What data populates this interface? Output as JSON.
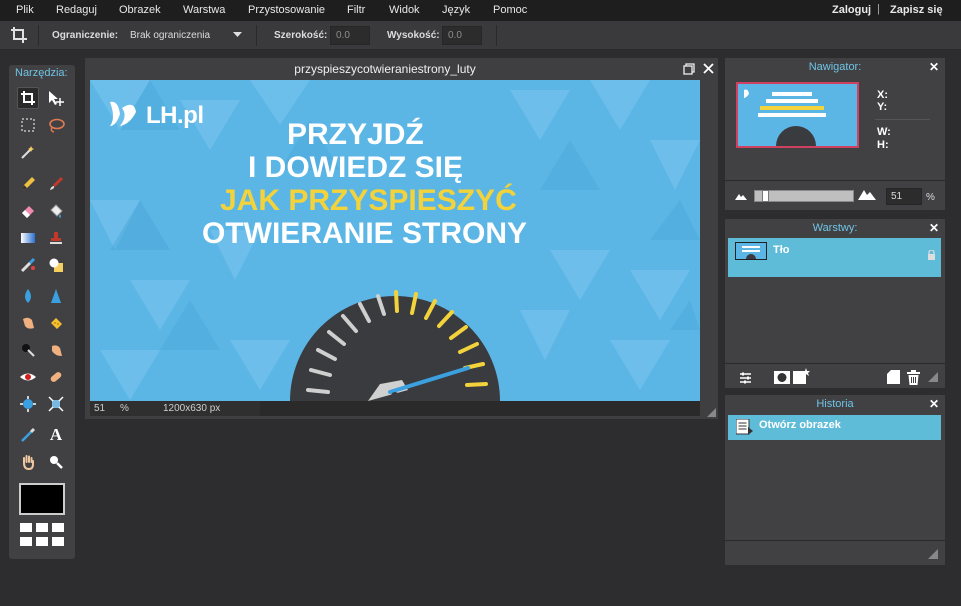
{
  "menu": {
    "items": [
      "Plik",
      "Redaguj",
      "Obrazek",
      "Warstwa",
      "Przystosowanie",
      "Filtr",
      "Widok",
      "Język",
      "Pomoc"
    ],
    "login": "Zaloguj",
    "separator": "|",
    "signup": "Zapisz się"
  },
  "options": {
    "constraint_label": "Ograniczenie:",
    "constraint_value": "Brak ograniczenia",
    "width_label": "Szerokość:",
    "width_value": "0.0",
    "height_label": "Wysokość:",
    "height_value": "0.0"
  },
  "tools": {
    "title": "Narzędzia:"
  },
  "canvas": {
    "title": "przyspieszycotwieraniestrony_luty",
    "zoom": "51",
    "zoom_unit": "%",
    "dimensions": "1200x630 px",
    "artwork": {
      "logo": "LH.pl",
      "line1": "PRZYJDŹ",
      "line2": "I DOWIEDZ SIĘ",
      "line3": "JAK PRZYSPIESZYĆ",
      "line4": "OTWIERANIE STRONY"
    }
  },
  "navigator": {
    "title": "Nawigator:",
    "x_label": "X:",
    "y_label": "Y:",
    "w_label": "W:",
    "h_label": "H:",
    "zoom_value": "51",
    "zoom_unit": "%",
    "zoom_slider_fraction": 0.08
  },
  "layers": {
    "title": "Warstwy:",
    "items": [
      {
        "name": "Tło"
      }
    ]
  },
  "history": {
    "title": "Historia",
    "items": [
      {
        "name": "Otwórz obrazek"
      }
    ]
  },
  "colors": {
    "accent": "#6fc4e6",
    "selected_row": "#5fbcd8",
    "artwork_bg": "#5bb6e6",
    "headline_yellow": "#f2d33b"
  }
}
